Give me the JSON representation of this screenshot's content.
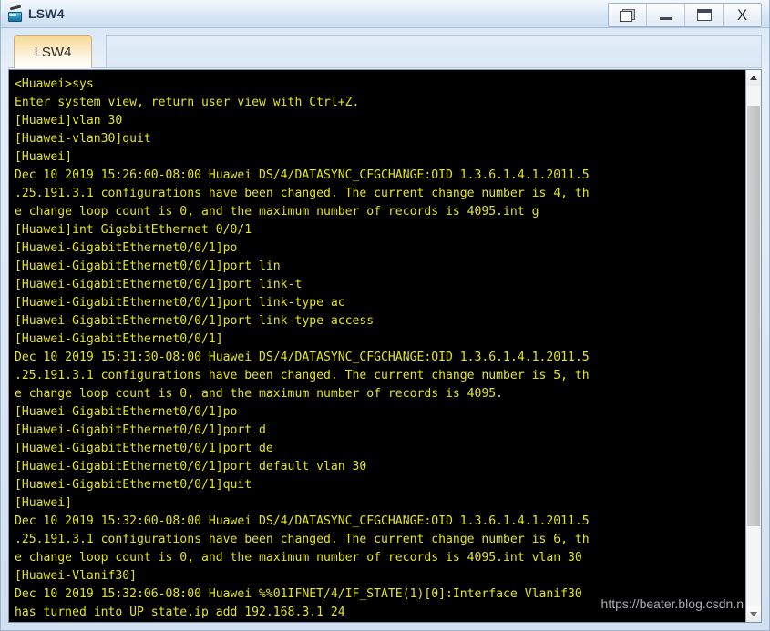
{
  "window": {
    "title": "LSW4",
    "icon": "switch-icon",
    "controls": {
      "restore_label": "",
      "minimize_label": "",
      "maximize_label": "",
      "close_label": "X"
    }
  },
  "tabs": [
    {
      "label": "LSW4",
      "active": true
    }
  ],
  "terminal": {
    "background": "#000000",
    "foreground": "#e3e326",
    "lines": [
      "<Huawei>sys",
      "Enter system view, return user view with Ctrl+Z.",
      "[Huawei]vlan 30",
      "[Huawei-vlan30]quit",
      "[Huawei]",
      "Dec 10 2019 15:26:00-08:00 Huawei DS/4/DATASYNC_CFGCHANGE:OID 1.3.6.1.4.1.2011.5",
      ".25.191.3.1 configurations have been changed. The current change number is 4, th",
      "e change loop count is 0, and the maximum number of records is 4095.int g",
      "[Huawei]int GigabitEthernet 0/0/1",
      "[Huawei-GigabitEthernet0/0/1]po",
      "[Huawei-GigabitEthernet0/0/1]port lin",
      "[Huawei-GigabitEthernet0/0/1]port link-t",
      "[Huawei-GigabitEthernet0/0/1]port link-type ac",
      "[Huawei-GigabitEthernet0/0/1]port link-type access",
      "[Huawei-GigabitEthernet0/0/1]",
      "Dec 10 2019 15:31:30-08:00 Huawei DS/4/DATASYNC_CFGCHANGE:OID 1.3.6.1.4.1.2011.5",
      ".25.191.3.1 configurations have been changed. The current change number is 5, th",
      "e change loop count is 0, and the maximum number of records is 4095.",
      "[Huawei-GigabitEthernet0/0/1]po",
      "[Huawei-GigabitEthernet0/0/1]port d",
      "[Huawei-GigabitEthernet0/0/1]port de",
      "[Huawei-GigabitEthernet0/0/1]port default vlan 30",
      "[Huawei-GigabitEthernet0/0/1]quit",
      "[Huawei]",
      "Dec 10 2019 15:32:00-08:00 Huawei DS/4/DATASYNC_CFGCHANGE:OID 1.3.6.1.4.1.2011.5",
      ".25.191.3.1 configurations have been changed. The current change number is 6, th",
      "e change loop count is 0, and the maximum number of records is 4095.int vlan 30",
      "[Huawei-Vlanif30]",
      "Dec 10 2019 15:32:06-08:00 Huawei %%01IFNET/4/IF_STATE(1)[0]:Interface Vlanif30",
      "has turned into UP state.ip add 192.168.3.1 24"
    ],
    "watermark": "https://beater.blog.csdn.n"
  },
  "scrollbar": {
    "up_arrow": "chevron-up-icon",
    "down_arrow": "chevron-down-icon"
  }
}
